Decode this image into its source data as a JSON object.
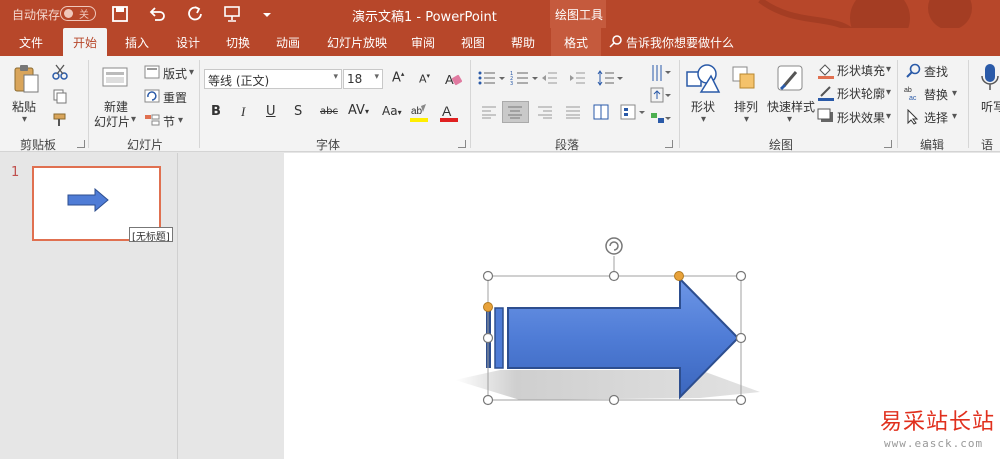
{
  "titlebar": {
    "autosave_label": "自动保存",
    "autosave_state": "关",
    "doc_title": "演示文稿1  -  PowerPoint",
    "context_group": "绘图工具"
  },
  "tabs": {
    "file": "文件",
    "home": "开始",
    "insert": "插入",
    "design": "设计",
    "transitions": "切换",
    "animations": "动画",
    "slideshow": "幻灯片放映",
    "review": "审阅",
    "view": "视图",
    "help": "帮助",
    "format": "格式",
    "tell_me": "告诉我你想要做什么"
  },
  "ribbon": {
    "clipboard": {
      "paste": "粘贴",
      "label": "剪贴板"
    },
    "slides": {
      "new_slide_line1": "新建",
      "new_slide_line2": "幻灯片",
      "layout": "版式",
      "reset": "重置",
      "section": "节",
      "label": "幻灯片"
    },
    "font": {
      "font_name": "等线 (正文)",
      "font_size": "18",
      "label": "字体"
    },
    "paragraph": {
      "label": "段落"
    },
    "drawing": {
      "shapes": "形状",
      "arrange": "排列",
      "quick_styles": "快速样式",
      "shape_fill": "形状填充",
      "shape_outline": "形状轮廓",
      "shape_effects": "形状效果",
      "label": "绘图"
    },
    "editing": {
      "find": "查找",
      "replace": "替换",
      "select": "选择",
      "label": "编辑"
    },
    "voice": {
      "dictate": "听写",
      "label": "语音"
    }
  },
  "thumbnails": {
    "slide_number": "1",
    "tooltip": "[无标题]"
  },
  "watermark": {
    "site_name": "易采站长站",
    "url": "www.easck.com"
  },
  "colors": {
    "accent": "#b7472a",
    "shape_fill": "#4f7cd6",
    "shape_dark": "#2d4e8f",
    "handle": "#e8a23a"
  }
}
